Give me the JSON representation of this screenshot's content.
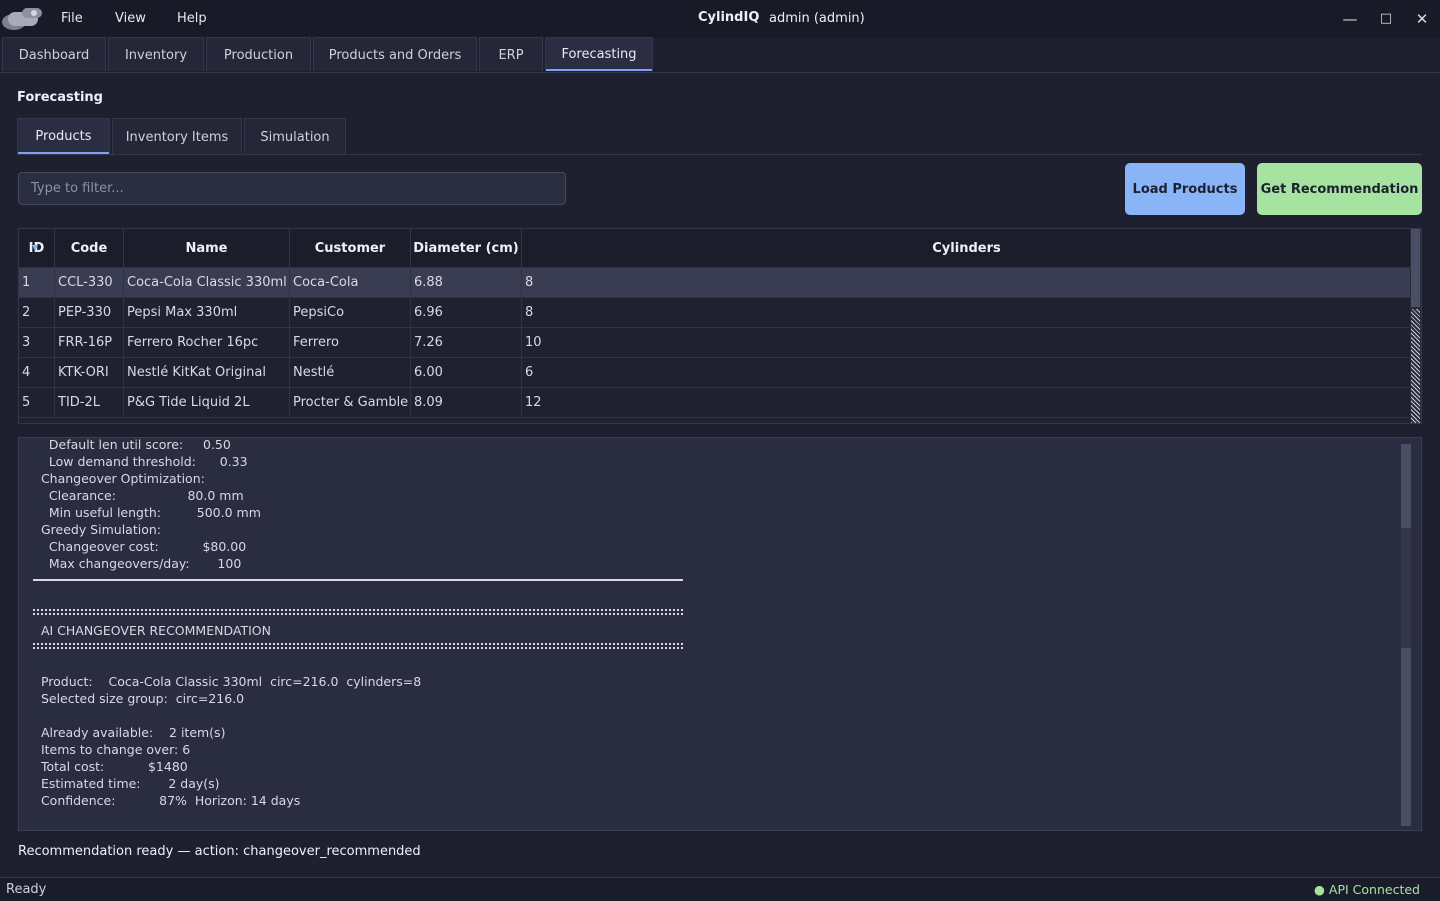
{
  "window": {
    "menu": [
      "File",
      "View",
      "Help"
    ],
    "app_title": "CylindIQ",
    "user": "admin  (admin)",
    "controls": {
      "minimize": "—",
      "maximize": "□",
      "close": "✕"
    }
  },
  "main_tabs": [
    "Dashboard",
    "Inventory",
    "Production",
    "Products and Orders",
    "ERP",
    "Forecasting"
  ],
  "active_main_tab": "Forecasting",
  "section_title": "Forecasting",
  "sub_tabs": [
    "Products",
    "Inventory Items",
    "Simulation"
  ],
  "active_sub_tab": "Products",
  "filter": {
    "placeholder": "Type to filter...",
    "value": ""
  },
  "buttons": {
    "load_products": "Load Products",
    "get_recommendation": "Get Recommendation"
  },
  "colors": {
    "accent": "#7aa2f7",
    "load_button": "#8ab4f8",
    "recommend_button": "#a6e3a1",
    "api_ok": "#a6e3a1"
  },
  "table": {
    "columns": [
      "ID",
      "Code",
      "Name",
      "Customer",
      "Diameter (cm)",
      "Cylinders"
    ],
    "sorted_by": "ID",
    "rows": [
      [
        "1",
        "CCL-330",
        "Coca-Cola Classic 330ml",
        "Coca-Cola",
        "6.88",
        "8"
      ],
      [
        "2",
        "PEP-330",
        "Pepsi Max 330ml",
        "PepsiCo",
        "6.96",
        "8"
      ],
      [
        "3",
        "FRR-16P",
        "Ferrero Rocher 16pc",
        "Ferrero",
        "7.26",
        "10"
      ],
      [
        "4",
        "KTK-ORI",
        "Nestlé KitKat Original",
        "Nestlé",
        "6.00",
        "6"
      ],
      [
        "5",
        "TID-2L",
        "P&G Tide Liquid 2L",
        "Procter & Gamble",
        "8.09",
        "12"
      ]
    ],
    "selected_row": 0
  },
  "output": {
    "lines_top": [
      "    Default len util score:     0.50",
      "    Low demand threshold:      0.33",
      "  Changeover Optimization:",
      "    Clearance:                  80.0 mm",
      "    Min useful length:         500.0 mm",
      "  Greedy Simulation:",
      "    Changeover cost:           $80.00",
      "    Max changeovers/day:       100"
    ],
    "heading": "  AI CHANGEOVER RECOMMENDATION",
    "lines_bottom": [
      "  Product:    Coca-Cola Classic 330ml  circ=216.0  cylinders=8",
      "  Selected size group:  circ=216.0",
      "",
      "  Already available:    2 item(s)",
      "  Items to change over: 6",
      "  Total cost:           $1480",
      "  Estimated time:       2 day(s)",
      "  Confidence:           87%  Horizon: 14 days"
    ]
  },
  "recommendation_status": "Recommendation ready — action: changeover_recommended",
  "statusbar": {
    "left": "Ready",
    "right": "● API Connected"
  }
}
